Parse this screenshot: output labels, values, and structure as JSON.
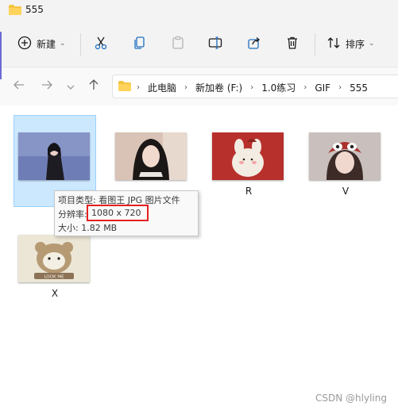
{
  "window": {
    "title": "555"
  },
  "toolbar": {
    "new_label": "新建",
    "sort_label": "排序"
  },
  "address": {
    "crumbs": [
      "此电脑",
      "新加卷 (F:)",
      "1.0练习",
      "GIF",
      "555"
    ]
  },
  "files": [
    {
      "name": "",
      "selected": true
    },
    {
      "name": "",
      "selected": false
    },
    {
      "name": "R",
      "selected": false
    },
    {
      "name": "V",
      "selected": false
    },
    {
      "name": "X",
      "selected": false
    }
  ],
  "tooltip": {
    "type_line": "项目类型: 看图王 JPG 图片文件",
    "res_label": "分辨率:",
    "res_value": "1080 x 720",
    "size_line": "大小: 1.82 MB"
  },
  "watermark": "CSDN @hlyling",
  "colors": {
    "selection_bg": "#cce8ff",
    "selection_border": "#99d1ff",
    "highlight_box": "#e52020",
    "folder": "#f4c542"
  }
}
